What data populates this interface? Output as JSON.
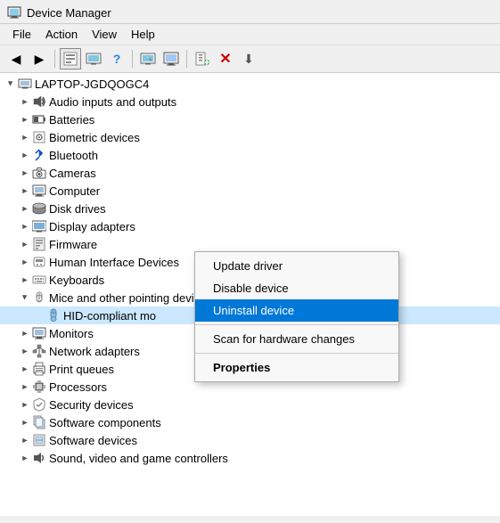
{
  "window": {
    "title": "Device Manager",
    "title_icon": "🖥"
  },
  "menu": {
    "items": [
      "File",
      "Action",
      "View",
      "Help"
    ]
  },
  "toolbar": {
    "buttons": [
      {
        "name": "back",
        "icon": "◀",
        "label": "Back"
      },
      {
        "name": "forward",
        "icon": "▶",
        "label": "Forward"
      },
      {
        "name": "properties",
        "icon": "▦",
        "label": "Properties"
      },
      {
        "name": "update-driver",
        "icon": "📋",
        "label": "Update Driver"
      },
      {
        "name": "help",
        "icon": "❓",
        "label": "Help"
      },
      {
        "name": "scan",
        "icon": "🖥",
        "label": "Scan for hardware changes"
      },
      {
        "name": "monitor-icon2",
        "icon": "🖥",
        "label": "Monitor"
      },
      {
        "name": "add",
        "icon": "➕",
        "label": "Add"
      },
      {
        "name": "remove",
        "icon": "✖",
        "label": "Remove"
      },
      {
        "name": "refresh",
        "icon": "⬇",
        "label": "Refresh"
      }
    ]
  },
  "tree": {
    "root": {
      "label": "LAPTOP-JGDQOGC4",
      "icon": "💻",
      "expanded": true
    },
    "items": [
      {
        "label": "Audio inputs and outputs",
        "icon": "🔊",
        "level": 1,
        "hasArrow": true,
        "expanded": false
      },
      {
        "label": "Batteries",
        "icon": "🔋",
        "level": 1,
        "hasArrow": true,
        "expanded": false
      },
      {
        "label": "Biometric devices",
        "icon": "📸",
        "level": 1,
        "hasArrow": true,
        "expanded": false
      },
      {
        "label": "Bluetooth",
        "icon": "🔵",
        "level": 1,
        "hasArrow": true,
        "expanded": false
      },
      {
        "label": "Cameras",
        "icon": "📷",
        "level": 1,
        "hasArrow": true,
        "expanded": false
      },
      {
        "label": "Computer",
        "icon": "💻",
        "level": 1,
        "hasArrow": true,
        "expanded": false
      },
      {
        "label": "Disk drives",
        "icon": "💾",
        "level": 1,
        "hasArrow": true,
        "expanded": false
      },
      {
        "label": "Display adapters",
        "icon": "🖥",
        "level": 1,
        "hasArrow": true,
        "expanded": false
      },
      {
        "label": "Firmware",
        "icon": "📦",
        "level": 1,
        "hasArrow": true,
        "expanded": false
      },
      {
        "label": "Human Interface Devices",
        "icon": "🎮",
        "level": 1,
        "hasArrow": true,
        "expanded": false
      },
      {
        "label": "Keyboards",
        "icon": "⌨",
        "level": 1,
        "hasArrow": true,
        "expanded": false
      },
      {
        "label": "Mice and other pointing devices",
        "icon": "🖱",
        "level": 1,
        "hasArrow": true,
        "expanded": true
      },
      {
        "label": "HID-compliant mo",
        "icon": "🖱",
        "level": 2,
        "hasArrow": false,
        "expanded": false,
        "selected": true
      },
      {
        "label": "Monitors",
        "icon": "🖥",
        "level": 1,
        "hasArrow": true,
        "expanded": false
      },
      {
        "label": "Network adapters",
        "icon": "🌐",
        "level": 1,
        "hasArrow": true,
        "expanded": false
      },
      {
        "label": "Print queues",
        "icon": "🖨",
        "level": 1,
        "hasArrow": true,
        "expanded": false
      },
      {
        "label": "Processors",
        "icon": "⚙",
        "level": 1,
        "hasArrow": true,
        "expanded": false
      },
      {
        "label": "Security devices",
        "icon": "🔒",
        "level": 1,
        "hasArrow": true,
        "expanded": false
      },
      {
        "label": "Software components",
        "icon": "📦",
        "level": 1,
        "hasArrow": true,
        "expanded": false
      },
      {
        "label": "Software devices",
        "icon": "📦",
        "level": 1,
        "hasArrow": true,
        "expanded": false
      },
      {
        "label": "Sound, video and game controllers",
        "icon": "🔊",
        "level": 1,
        "hasArrow": true,
        "expanded": false
      }
    ]
  },
  "context_menu": {
    "items": [
      {
        "label": "Update driver",
        "type": "normal"
      },
      {
        "label": "Disable device",
        "type": "normal"
      },
      {
        "label": "Uninstall device",
        "type": "highlighted"
      },
      {
        "label": "Scan for hardware changes",
        "type": "normal"
      },
      {
        "label": "Properties",
        "type": "bold"
      }
    ]
  }
}
